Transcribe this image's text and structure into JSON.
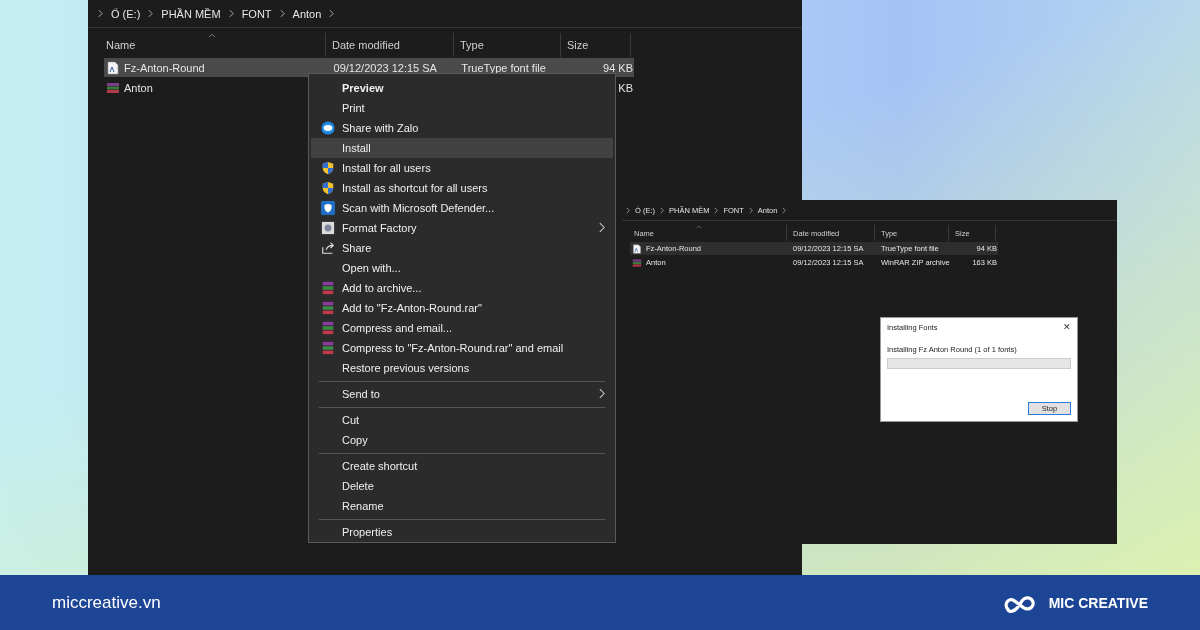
{
  "explorer_main": {
    "breadcrumb": [
      "Ổ (E:)",
      "PHẦN MỀM",
      "FONT",
      "Anton"
    ],
    "columns": [
      "Name",
      "Date modified",
      "Type",
      "Size"
    ],
    "rows": [
      {
        "kind": "font",
        "name": "Fz-Anton-Round",
        "date": "09/12/2023 12:15 SA",
        "type": "TrueType font file",
        "size": "94 KB",
        "selected": true
      },
      {
        "kind": "archive",
        "name": "Anton",
        "size": "KB",
        "selected": false
      }
    ]
  },
  "context_menu": {
    "items": [
      {
        "kind": "item",
        "label": "Preview",
        "default": true,
        "selected": false,
        "submenu": false
      },
      {
        "kind": "item",
        "label": "Print",
        "default": false,
        "selected": false,
        "submenu": false
      },
      {
        "kind": "zalo",
        "label": "Share with Zalo",
        "default": false,
        "selected": false,
        "submenu": false
      },
      {
        "kind": "item",
        "label": "Install",
        "default": false,
        "selected": true,
        "submenu": false
      },
      {
        "kind": "uac",
        "label": "Install for all users",
        "default": false,
        "selected": false,
        "submenu": false
      },
      {
        "kind": "uac",
        "label": "Install as shortcut for all users",
        "default": false,
        "selected": false,
        "submenu": false
      },
      {
        "kind": "defender",
        "label": "Scan with Microsoft Defender...",
        "default": false,
        "selected": false,
        "submenu": false
      },
      {
        "kind": "formatfactory",
        "label": "Format Factory",
        "default": false,
        "selected": false,
        "submenu": true
      },
      {
        "kind": "share",
        "label": "Share",
        "default": false,
        "selected": false,
        "submenu": false
      },
      {
        "kind": "item",
        "label": "Open with...",
        "default": false,
        "selected": false,
        "submenu": false
      },
      {
        "kind": "winrar",
        "label": "Add to archive...",
        "default": false,
        "selected": false,
        "submenu": false
      },
      {
        "kind": "winrar",
        "label": "Add to \"Fz-Anton-Round.rar\"",
        "default": false,
        "selected": false,
        "submenu": false
      },
      {
        "kind": "winrar",
        "label": "Compress and email...",
        "default": false,
        "selected": false,
        "submenu": false
      },
      {
        "kind": "winrar",
        "label": "Compress to \"Fz-Anton-Round.rar\" and email",
        "default": false,
        "selected": false,
        "submenu": false
      },
      {
        "kind": "item",
        "label": "Restore previous versions",
        "default": false,
        "selected": false,
        "submenu": false
      },
      {
        "kind": "separator"
      },
      {
        "kind": "item",
        "label": "Send to",
        "default": false,
        "selected": false,
        "submenu": true
      },
      {
        "kind": "separator"
      },
      {
        "kind": "item",
        "label": "Cut",
        "default": false,
        "selected": false,
        "submenu": false
      },
      {
        "kind": "item",
        "label": "Copy",
        "default": false,
        "selected": false,
        "submenu": false
      },
      {
        "kind": "separator"
      },
      {
        "kind": "item",
        "label": "Create shortcut",
        "default": false,
        "selected": false,
        "submenu": false
      },
      {
        "kind": "item",
        "label": "Delete",
        "default": false,
        "selected": false,
        "submenu": false
      },
      {
        "kind": "item",
        "label": "Rename",
        "default": false,
        "selected": false,
        "submenu": false
      },
      {
        "kind": "separator"
      },
      {
        "kind": "item",
        "label": "Properties",
        "default": false,
        "selected": false,
        "submenu": false
      }
    ]
  },
  "explorer_second": {
    "breadcrumb": [
      "Ổ (E:)",
      "PHẦN MỀM",
      "FONT",
      "Anton"
    ],
    "columns": [
      "Name",
      "Date modified",
      "Type",
      "Size"
    ],
    "rows": [
      {
        "kind": "font",
        "name": "Fz-Anton-Round",
        "date": "09/12/2023 12:15 SA",
        "type": "TrueType font file",
        "size": "94 KB",
        "selected": true
      },
      {
        "kind": "archive",
        "name": "Anton",
        "date": "09/12/2023 12:15 SA",
        "type": "WinRAR ZIP archive",
        "size": "163 KB",
        "selected": false
      }
    ]
  },
  "install_dialog": {
    "title": "Installing Fonts",
    "close": "✕",
    "message": "Installing Fz Anton Round (1 of 1 fonts)",
    "level": 0,
    "button": "Stop"
  },
  "footer": {
    "site": "miccreative.vn",
    "brand": "MIC CREATIVE"
  }
}
